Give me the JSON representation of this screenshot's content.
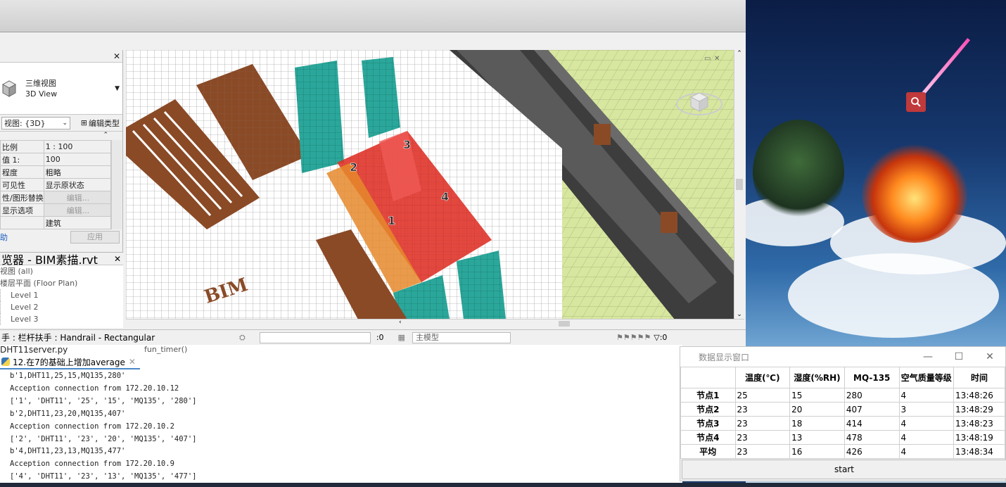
{
  "revit": {
    "properties": {
      "type_name_cn": "三维视图",
      "type_name_en": "3D View",
      "view_selector": "视图: {3D}",
      "edit_type": "编辑类型",
      "rows": [
        {
          "label": "比例",
          "value": "1 : 100"
        },
        {
          "label": "值 1:",
          "value": "100"
        },
        {
          "label": "程度",
          "value": "粗略"
        },
        {
          "label": "可见性",
          "value": "显示原状态"
        },
        {
          "label": "性/图形替换",
          "value": "编辑..."
        },
        {
          "label": "显示选项",
          "value": "编辑..."
        },
        {
          "label": "",
          "value": "建筑"
        }
      ],
      "help": "助",
      "apply": "应用"
    },
    "browser": {
      "title": "览器 - BIM素描.rvt",
      "items": [
        "视图 (all)",
        "楼层平面 (Floor Plan)",
        "Level 1",
        "Level 2",
        "Level 3"
      ]
    },
    "status": {
      "selection": "手 : 栏杆扶手 : Handrail - Rectangular",
      "count_left": ":0",
      "model": "主模型",
      "filter_count": ":0"
    }
  },
  "ide": {
    "filename": "DHT11server.py",
    "func": "fun_timer()",
    "tab": "12.在7的基础上增加average",
    "console": [
      "b'1,DHT11,25,15,MQ135,280'",
      "Acception connection from 172.20.10.12",
      "['1', 'DHT11', '25', '15', 'MQ135', '280']",
      "b'2,DHT11,23,20,MQ135,407'",
      "Acception connection from 172.20.10.2",
      "['2', 'DHT11', '23', '20', 'MQ135', '407']",
      "b'4,DHT11,23,13,MQ135,477'",
      "Acception connection from 172.20.10.9",
      "['4', 'DHT11', '23', '13', 'MQ135', '477']"
    ]
  },
  "data_window": {
    "title": "数据显示窗口",
    "columns": [
      "温度(℃)",
      "湿度(%RH)",
      "MQ-135",
      "空气质量等级",
      "时间"
    ],
    "rows": [
      {
        "name": "节点1",
        "cells": [
          "25",
          "15",
          "280",
          "4",
          "13:48:26"
        ]
      },
      {
        "name": "节点2",
        "cells": [
          "23",
          "20",
          "407",
          "3",
          "13:48:29"
        ]
      },
      {
        "name": "节点3",
        "cells": [
          "23",
          "18",
          "414",
          "4",
          "13:48:23"
        ]
      },
      {
        "name": "节点4",
        "cells": [
          "23",
          "13",
          "478",
          "4",
          "13:48:19"
        ]
      },
      {
        "name": "平均",
        "cells": [
          "23",
          "16",
          "426",
          "4",
          "13:48:34"
        ]
      }
    ],
    "start": "start"
  },
  "viewport": {
    "room_labels": [
      "1",
      "2",
      "3",
      "4"
    ],
    "sign_text": "BIM"
  },
  "colors": {
    "grass": "#d7e7a0",
    "room_red": "#e0342a",
    "wall_teal": "#2aa79a",
    "roof_brown": "#8a4a26",
    "accent_blue": "#4a88c7"
  }
}
